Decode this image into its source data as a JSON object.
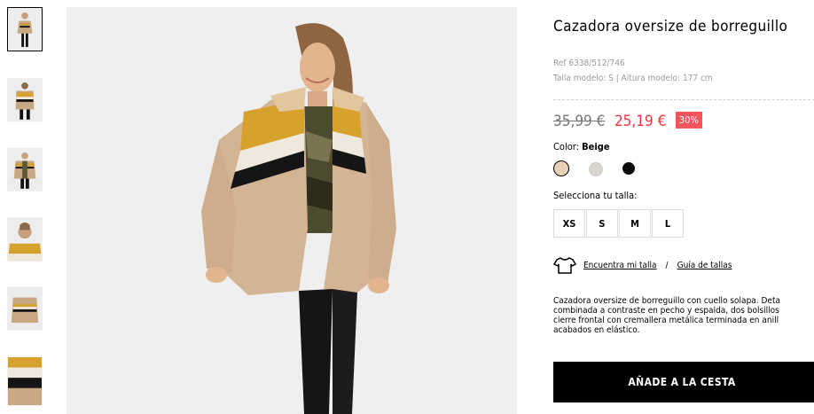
{
  "product": {
    "title": "Cazadora oversize de borreguillo",
    "ref": "Ref 6338/512/746",
    "model_info": "Talla modelo: S | Altura modelo: 177 cm",
    "old_price": "35,99 €",
    "new_price": "25,19 €",
    "discount": "30%",
    "color_prefix": "Color:",
    "color_value": "Beige",
    "colors": [
      {
        "name": "beige",
        "hex": "#e7d2b7",
        "selected": true
      },
      {
        "name": "light-grey",
        "hex": "#d9d6cf",
        "selected": false
      },
      {
        "name": "black",
        "hex": "#0c0c0c",
        "selected": false
      }
    ],
    "size_prompt": "Selecciona tu talla:",
    "sizes": [
      "XS",
      "S",
      "M",
      "L"
    ],
    "find_size_link": "Encuentra mi talla",
    "separator": "/",
    "size_guide_link": "Guía de tallas",
    "description_lines": [
      "Cazadora oversize de borreguillo con cuello solapa. Deta",
      "combinada a contraste en pecho y espalda, dos bolsillos",
      "cierre frontal con cremallera metálica terminada en anill",
      "acabados en elástico."
    ],
    "add_to_cart": "AÑADE A LA CESTA"
  },
  "gallery": {
    "thumbnails": [
      {
        "name": "full-body-front",
        "selected": true
      },
      {
        "name": "back-view",
        "selected": false
      },
      {
        "name": "front-open",
        "selected": false
      },
      {
        "name": "collar-closeup",
        "selected": false
      },
      {
        "name": "flat-lay",
        "selected": false
      },
      {
        "name": "fabric-detail",
        "selected": false
      }
    ]
  },
  "colors": {
    "accent_red": "#e8333f",
    "badge_red": "#f2545b",
    "jacket_tan": "#d2b393",
    "stripe_mustard": "#d6a12c",
    "stripe_cream": "#efe8dc",
    "stripe_black": "#151515"
  }
}
